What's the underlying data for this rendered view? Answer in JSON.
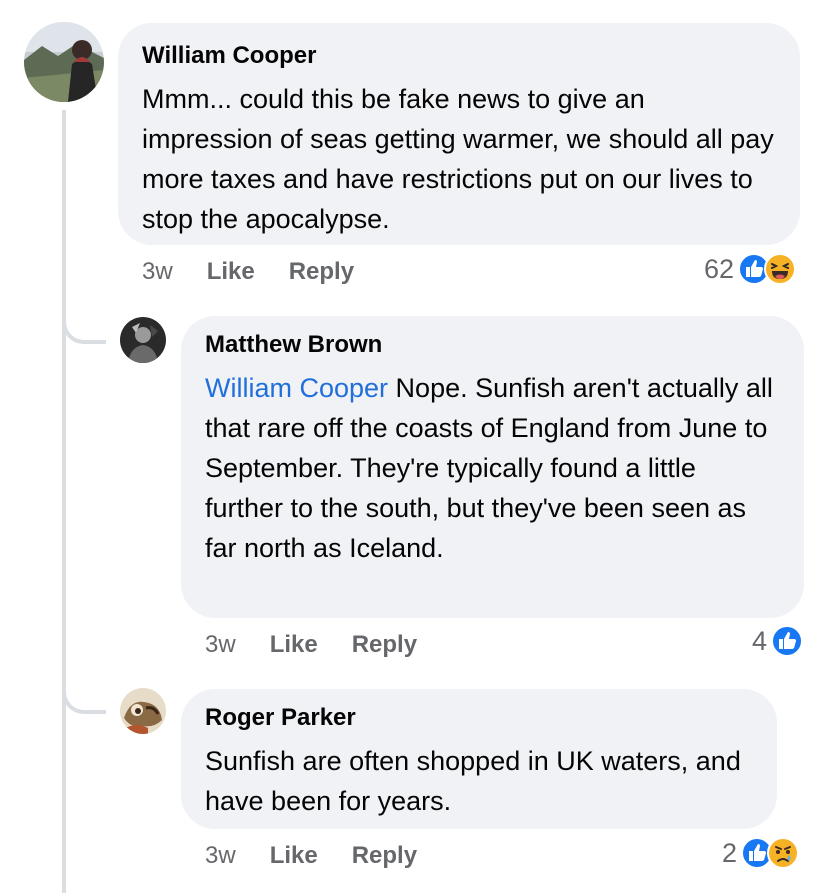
{
  "comments": [
    {
      "author": "William Cooper",
      "text": "Mmm... could this be fake news to give an impression of seas getting warmer, we should all pay more taxes and have restrictions put on our lives to stop the apocalypse.",
      "time": "3w",
      "like_label": "Like",
      "reply_label": "Reply",
      "reaction_count": "62",
      "reactions": [
        "like-icon",
        "haha-icon"
      ]
    }
  ],
  "replies": [
    {
      "author": "Matthew Brown",
      "mention": "William Cooper",
      "text": " Nope. Sunfish aren't actually all that rare off the coasts of England from June to September. They're typically found a little further to the south, but they've been seen as far north as Iceland.",
      "time": "3w",
      "like_label": "Like",
      "reply_label": "Reply",
      "reaction_count": "4",
      "reactions": [
        "like-icon"
      ]
    },
    {
      "author": "Roger Parker",
      "text": "Sunfish are often shopped in UK waters, and have been for years.",
      "time": "3w",
      "like_label": "Like",
      "reply_label": "Reply",
      "reaction_count": "2",
      "reactions": [
        "like-icon",
        "sad-icon"
      ]
    }
  ],
  "colors": {
    "bubble": "#f0f2f5",
    "mention": "#216fdb",
    "meta": "#65676b",
    "like": "#1877f2"
  }
}
